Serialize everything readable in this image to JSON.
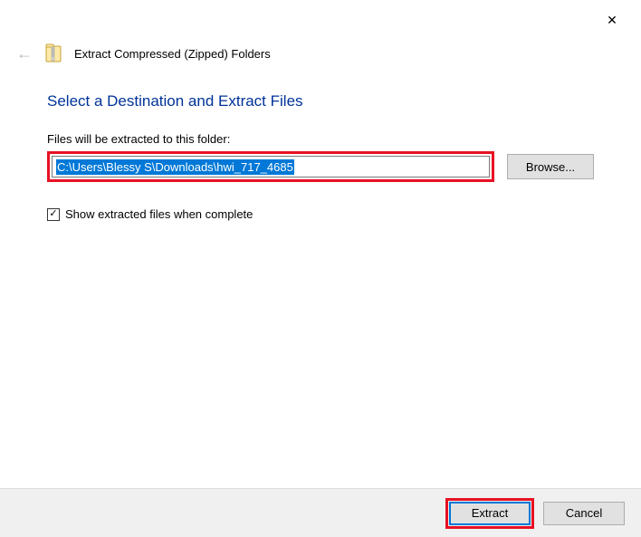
{
  "titlebar": {
    "close_glyph": "✕"
  },
  "header": {
    "back_arrow_glyph": "←",
    "window_title": "Extract Compressed (Zipped) Folders"
  },
  "main": {
    "heading": "Select a Destination and Extract Files",
    "destination_label": "Files will be extracted to this folder:",
    "destination_path": "C:\\Users\\Blessy S\\Downloads\\hwi_717_4685",
    "browse_label": "Browse...",
    "checkbox_checked_glyph": "✓",
    "checkbox_label": "Show extracted files when complete"
  },
  "footer": {
    "extract_label": "Extract",
    "cancel_label": "Cancel"
  }
}
